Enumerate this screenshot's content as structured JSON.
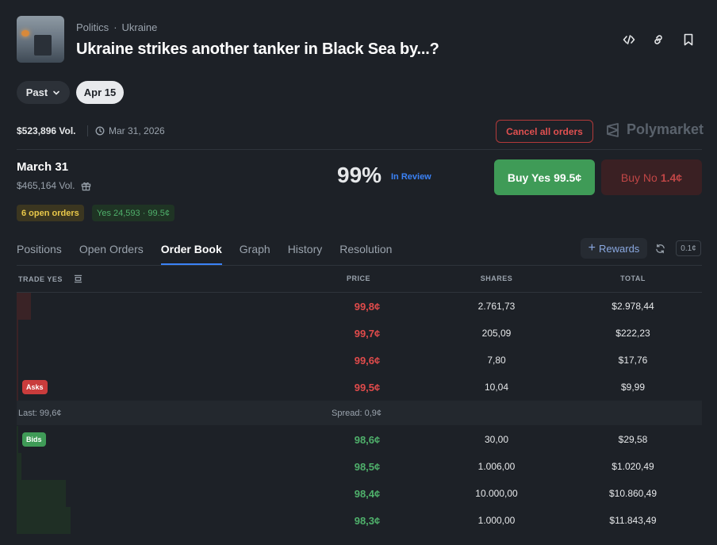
{
  "market": {
    "category": "Politics",
    "subcategory": "Ukraine",
    "title": "Ukraine strikes another tanker in Black Sea by...?",
    "filter_past": "Past",
    "filter_date": "Apr 15",
    "volume": "$523,896 Vol.",
    "end_date": "Mar 31, 2026",
    "cancel_label": "Cancel all orders",
    "brand": "Polymarket"
  },
  "outcome": {
    "name": "March 31",
    "volume": "$465,164 Vol.",
    "probability": "99%",
    "status": "In Review",
    "buy_yes_label": "Buy Yes",
    "buy_yes_price": "99.5¢",
    "buy_no_label": "Buy No",
    "buy_no_price": "1.4¢",
    "open_orders": "6 open orders",
    "position": "Yes 24,593 · 99.5¢"
  },
  "tabs": [
    "Positions",
    "Open Orders",
    "Order Book",
    "Graph",
    "History",
    "Resolution"
  ],
  "active_tab": "Order Book",
  "toolbar": {
    "rewards": "Rewards",
    "tick": "0.1¢"
  },
  "orderbook": {
    "headers": {
      "trade": "TRADE YES",
      "price": "PRICE",
      "shares": "SHARES",
      "total": "TOTAL"
    },
    "asks_label": "Asks",
    "bids_label": "Bids",
    "asks": [
      {
        "price": "99,8¢",
        "shares": "2.761,73",
        "total": "$2.978,44",
        "depth": 0.27
      },
      {
        "price": "99,7¢",
        "shares": "205,09",
        "total": "$222,23",
        "depth": 0.02
      },
      {
        "price": "99,6¢",
        "shares": "7,80",
        "total": "$17,76",
        "depth": 0.002
      },
      {
        "price": "99,5¢",
        "shares": "10,04",
        "total": "$9,99",
        "depth": 0.001
      }
    ],
    "last": "Last: 99,6¢",
    "spread": "Spread: 0,9¢",
    "bids": [
      {
        "price": "98,6¢",
        "shares": "30,00",
        "total": "$29,58",
        "depth": 0.003
      },
      {
        "price": "98,5¢",
        "shares": "1.006,00",
        "total": "$1.020,49",
        "depth": 0.09
      },
      {
        "price": "98,4¢",
        "shares": "10.000,00",
        "total": "$10.860,49",
        "depth": 0.91
      },
      {
        "price": "98,3¢",
        "shares": "1.000,00",
        "total": "$11.843,49",
        "depth": 1.0
      }
    ]
  },
  "colors": {
    "ask": "#e04b4b",
    "bid": "#4fb06b",
    "accent": "#3b82f6",
    "buy_yes_bg": "#3f9b57"
  }
}
